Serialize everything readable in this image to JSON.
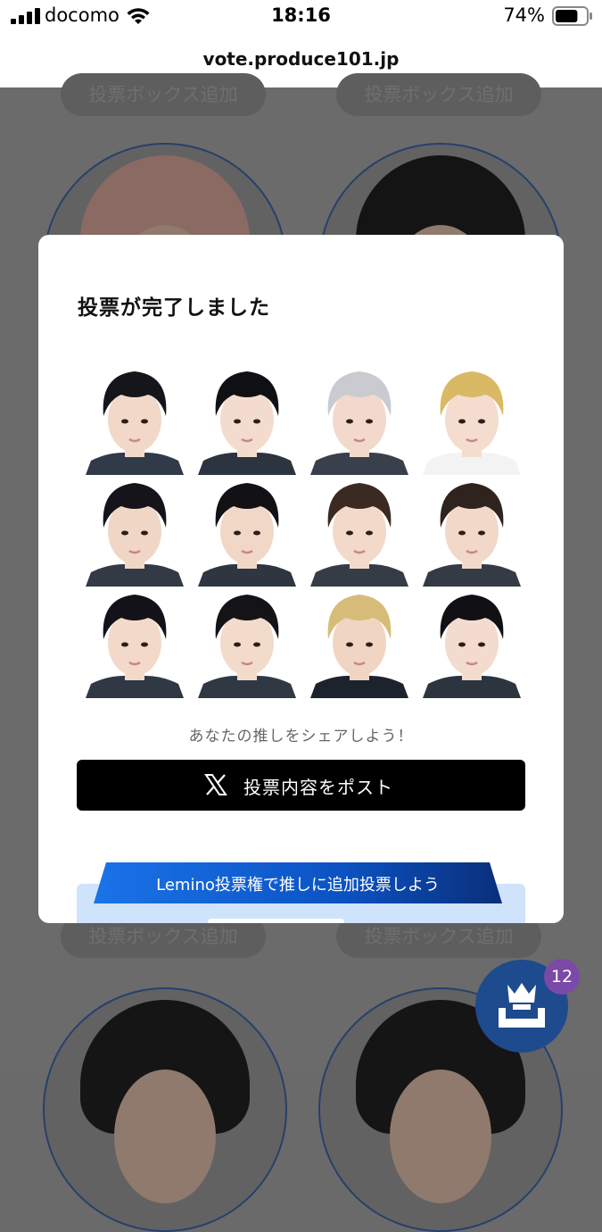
{
  "status_bar": {
    "carrier": "docomo",
    "time": "18:16",
    "battery_percent": "74%",
    "battery_level": 0.74,
    "icons": [
      "signal-icon",
      "wifi-icon",
      "battery-icon"
    ]
  },
  "browser": {
    "url": "vote.produce101.jp"
  },
  "background_page": {
    "add_box_label": "投票ボックス追加"
  },
  "modal": {
    "title": "投票が完了しました",
    "voted_trainees": [
      {
        "hair": "#15151c",
        "skin": "#f1d8c8",
        "clothes": "#303a48"
      },
      {
        "hair": "#101014",
        "skin": "#f3dccd",
        "clothes": "#2c3440"
      },
      {
        "hair": "#c9cbd0",
        "skin": "#f2d9cb",
        "clothes": "#39404c"
      },
      {
        "hair": "#d9b964",
        "skin": "#f4dccf",
        "clothes": "#f3f3f3"
      },
      {
        "hair": "#14141a",
        "skin": "#f0d6c5",
        "clothes": "#333a46"
      },
      {
        "hair": "#121216",
        "skin": "#f1d7c6",
        "clothes": "#2e3642"
      },
      {
        "hair": "#3a2a22",
        "skin": "#f2d9c9",
        "clothes": "#353c48"
      },
      {
        "hair": "#2f231d",
        "skin": "#f1d8c8",
        "clothes": "#343a46"
      },
      {
        "hair": "#121218",
        "skin": "#f2d9ca",
        "clothes": "#2f3844"
      },
      {
        "hair": "#141418",
        "skin": "#f3dbcc",
        "clothes": "#303844"
      },
      {
        "hair": "#d6bc78",
        "skin": "#f0d5c3",
        "clothes": "#1d232c"
      },
      {
        "hair": "#101015",
        "skin": "#f3dbcd",
        "clothes": "#2c3440"
      }
    ],
    "share_caption": "あなたの推しをシェアしよう！",
    "post_button": {
      "label": "投票内容をポスト",
      "icon": "x-logo-icon"
    },
    "lemino_banner": {
      "label": "Lemino投票権で推しに追加投票しよう"
    }
  },
  "floating_ballot": {
    "icon": "crown-ballot-icon",
    "count": "12"
  },
  "colors": {
    "accent_blue": "#1e4a8e",
    "banner_blue": "#0b53c4",
    "badge_purple": "#7b49a8",
    "overlay_gray": "#6b6b6b"
  }
}
